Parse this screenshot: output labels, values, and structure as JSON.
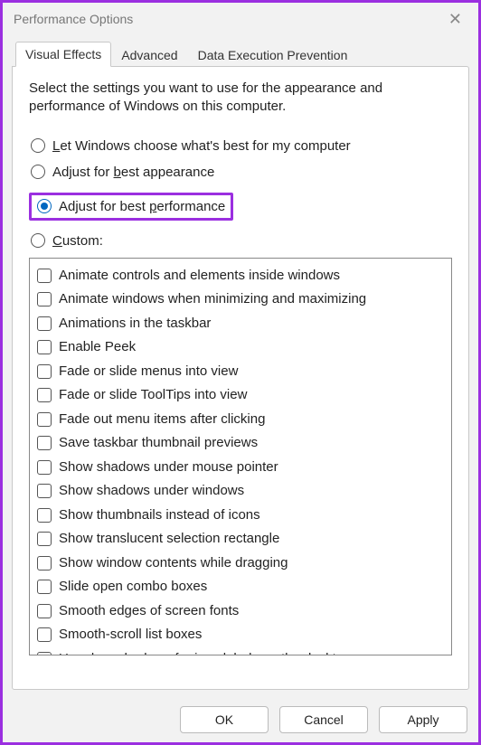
{
  "window": {
    "title": "Performance Options",
    "close_symbol": "✕"
  },
  "tabs": {
    "visual_effects": "Visual Effects",
    "advanced": "Advanced",
    "dep": "Data Execution Prevention"
  },
  "intro": "Select the settings you want to use for the appearance and performance of Windows on this computer.",
  "radios": {
    "let_windows_pre": "",
    "let_windows_u": "L",
    "let_windows_post": "et Windows choose what's best for my computer",
    "best_appearance_pre": "Adjust for ",
    "best_appearance_u": "b",
    "best_appearance_post": "est appearance",
    "best_performance_pre": "Adjust for best ",
    "best_performance_u": "p",
    "best_performance_post": "erformance",
    "custom_pre": "",
    "custom_u": "C",
    "custom_post": "ustom:"
  },
  "options": [
    "Animate controls and elements inside windows",
    "Animate windows when minimizing and maximizing",
    "Animations in the taskbar",
    "Enable Peek",
    "Fade or slide menus into view",
    "Fade or slide ToolTips into view",
    "Fade out menu items after clicking",
    "Save taskbar thumbnail previews",
    "Show shadows under mouse pointer",
    "Show shadows under windows",
    "Show thumbnails instead of icons",
    "Show translucent selection rectangle",
    "Show window contents while dragging",
    "Slide open combo boxes",
    "Smooth edges of screen fonts",
    "Smooth-scroll list boxes",
    "Use drop shadows for icon labels on the desktop"
  ],
  "buttons": {
    "ok": "OK",
    "cancel": "Cancel",
    "apply": "Apply"
  }
}
